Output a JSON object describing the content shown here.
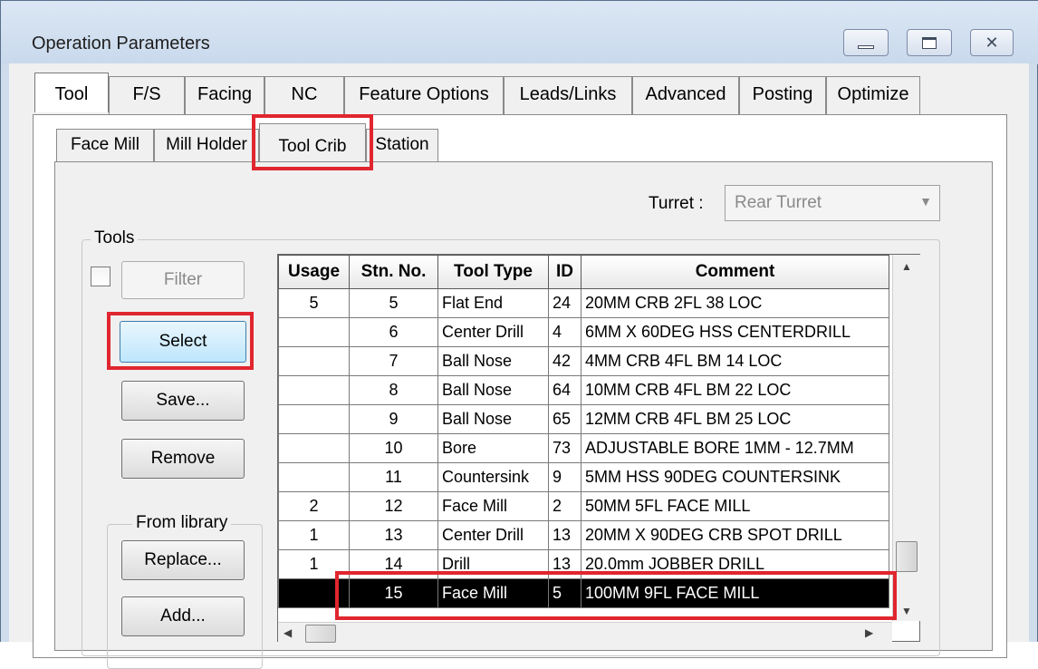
{
  "window": {
    "title": "Operation Parameters",
    "minimize_icon": "minimize-icon",
    "maximize_icon": "maximize-icon",
    "close_icon": "close-icon"
  },
  "tabs": [
    {
      "label": "Tool",
      "active": true
    },
    {
      "label": "F/S"
    },
    {
      "label": "Facing"
    },
    {
      "label": "NC"
    },
    {
      "label": "Feature Options"
    },
    {
      "label": "Leads/Links"
    },
    {
      "label": "Advanced"
    },
    {
      "label": "Posting"
    },
    {
      "label": "Optimize"
    }
  ],
  "subtabs": [
    {
      "label": "Face Mill"
    },
    {
      "label": "Mill Holder"
    },
    {
      "label": "Tool Crib",
      "active": true
    },
    {
      "label": "Station"
    }
  ],
  "turret": {
    "label": "Turret :",
    "value": "Rear Turret"
  },
  "tools_group": {
    "label": "Tools",
    "filter_button": "Filter",
    "select_button": "Select",
    "save_button": "Save...",
    "remove_button": "Remove",
    "from_library_label": "From library",
    "replace_button": "Replace...",
    "add_button": "Add..."
  },
  "table": {
    "columns": [
      "Usage",
      "Stn. No.",
      "Tool Type",
      "ID",
      "Comment"
    ],
    "rows": [
      [
        "5",
        "5",
        "Flat End",
        "24",
        "20MM CRB 2FL 38 LOC"
      ],
      [
        "",
        "6",
        "Center Drill",
        "4",
        "6MM X 60DEG HSS CENTERDRILL"
      ],
      [
        "",
        "7",
        "Ball Nose",
        "42",
        "4MM CRB 4FL BM 14 LOC"
      ],
      [
        "",
        "8",
        "Ball Nose",
        "64",
        "10MM CRB 4FL BM 22 LOC"
      ],
      [
        "",
        "9",
        "Ball Nose",
        "65",
        "12MM CRB 4FL BM 25 LOC"
      ],
      [
        "",
        "10",
        "Bore",
        "73",
        "ADJUSTABLE BORE 1MM - 12.7MM"
      ],
      [
        "",
        "11",
        "Countersink",
        "9",
        "5MM HSS 90DEG COUNTERSINK"
      ],
      [
        "2",
        "12",
        "Face Mill",
        "2",
        "50MM 5FL FACE MILL"
      ],
      [
        "1",
        "13",
        "Center Drill",
        "13",
        "20MM X 90DEG CRB SPOT DRILL"
      ],
      [
        "1",
        "14",
        "Drill",
        "13",
        "20.0mm JOBBER DRILL"
      ],
      [
        "",
        "15",
        "Face Mill",
        "5",
        "100MM 9FL FACE MILL"
      ]
    ],
    "selected_row_index": 10
  }
}
